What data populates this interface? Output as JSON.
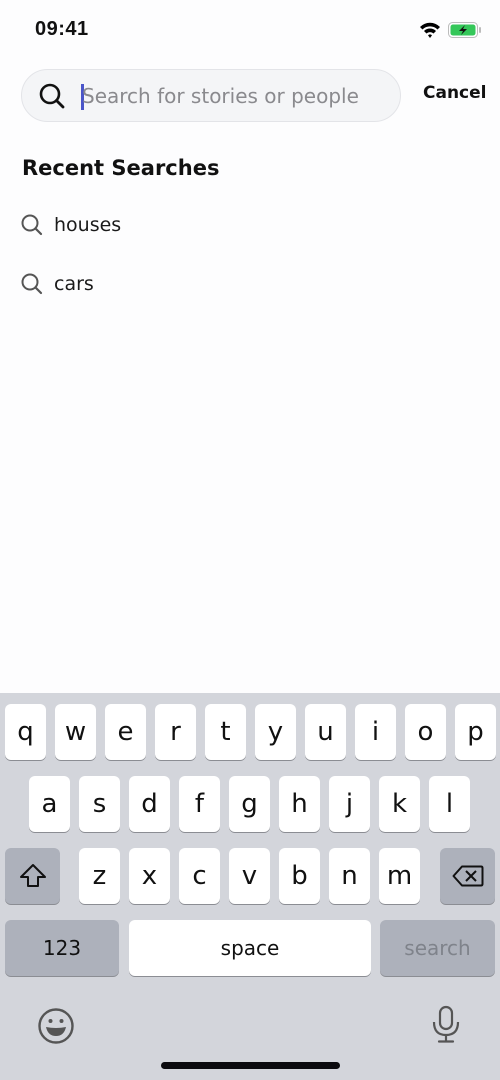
{
  "status_bar": {
    "time": "09:41",
    "battery_color": "#34c759"
  },
  "search": {
    "placeholder": "Search for stories or people",
    "value": "",
    "cancel_label": "Cancel",
    "caret_color": "#4a55c9"
  },
  "recent": {
    "title": "Recent Searches",
    "items": [
      {
        "label": "houses"
      },
      {
        "label": "cars"
      }
    ]
  },
  "keyboard": {
    "row1": [
      "q",
      "w",
      "e",
      "r",
      "t",
      "y",
      "u",
      "i",
      "o",
      "p"
    ],
    "row2": [
      "a",
      "s",
      "d",
      "f",
      "g",
      "h",
      "j",
      "k",
      "l"
    ],
    "row3": [
      "z",
      "x",
      "c",
      "v",
      "b",
      "n",
      "m"
    ],
    "numbers_label": "123",
    "space_label": "space",
    "action_label": "search",
    "icons": {
      "shift": "shift-icon",
      "delete": "delete-icon",
      "emoji": "emoji-icon",
      "mic": "microphone-icon"
    }
  }
}
